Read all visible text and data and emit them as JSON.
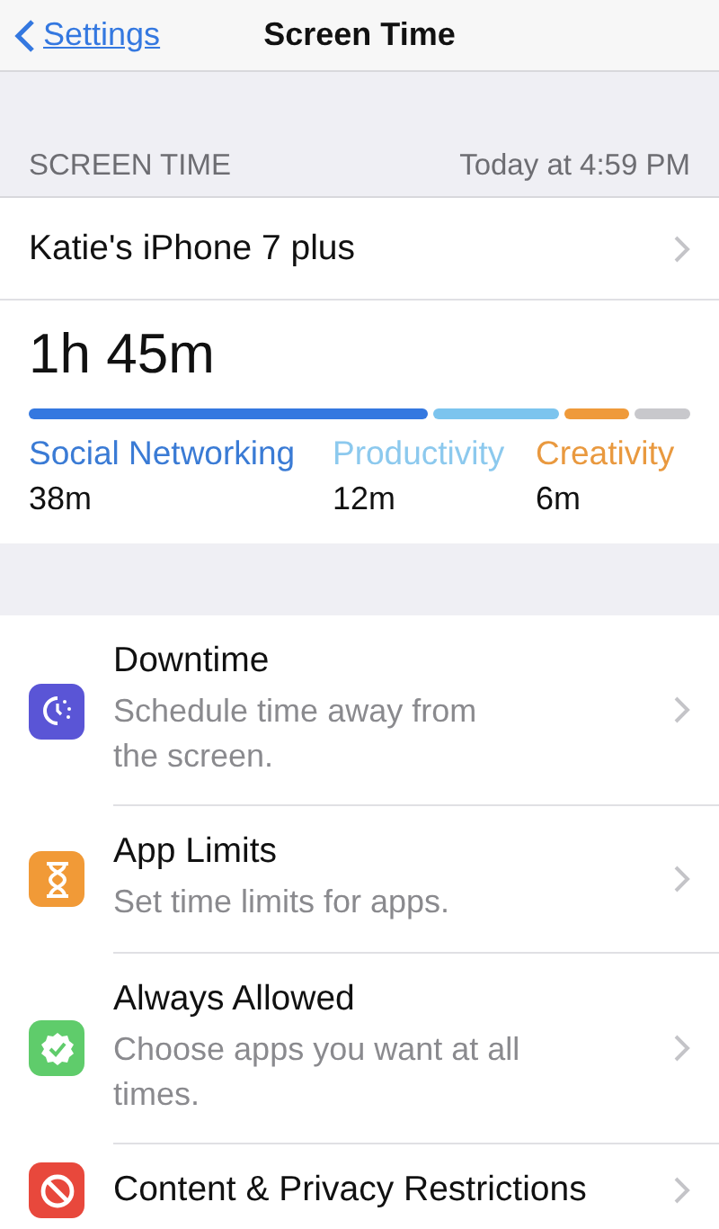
{
  "nav": {
    "back": "Settings",
    "title": "Screen Time"
  },
  "section": {
    "label": "SCREEN TIME",
    "time": "Today at 4:59 PM"
  },
  "device": {
    "name": "Katie's iPhone 7 plus"
  },
  "usage": {
    "total": "1h 45m",
    "segments": [
      {
        "color": "#3478e0"
      },
      {
        "color": "#7cc4ee"
      },
      {
        "color": "#ef9a3a"
      },
      {
        "color": "#c8c8cc"
      }
    ],
    "categories": [
      {
        "name": "Social Networking",
        "time": "38m",
        "color": "#3a7bd5"
      },
      {
        "name": "Productivity",
        "time": "12m",
        "color": "#8cc9ee"
      },
      {
        "name": "Creativity",
        "time": "6m",
        "color": "#e9993f"
      }
    ]
  },
  "items": [
    {
      "kind": "downtime",
      "title": "Downtime",
      "subtitle": "Schedule time away from the screen.",
      "color": "#5a55d6"
    },
    {
      "kind": "limits",
      "title": "App Limits",
      "subtitle": "Set time limits for apps.",
      "color": "#f19a37"
    },
    {
      "kind": "allowed",
      "title": "Always Allowed",
      "subtitle": "Choose apps you want at all times.",
      "color": "#5fcc6b"
    },
    {
      "kind": "restrictions",
      "title": "Content & Privacy Restrictions",
      "color": "#e8483c"
    }
  ]
}
